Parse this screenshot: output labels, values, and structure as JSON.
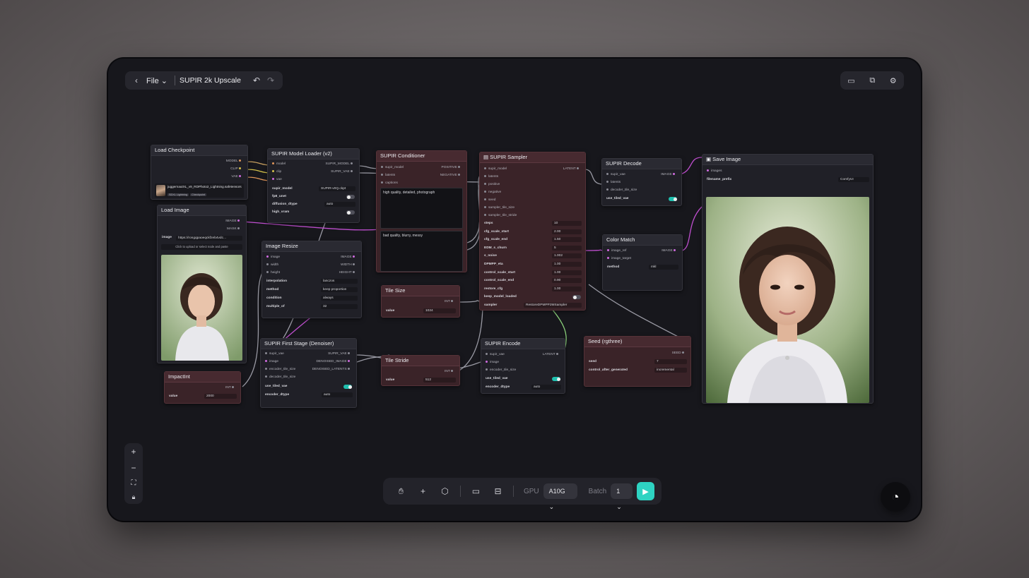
{
  "topbar": {
    "back_icon": "chevron-left-icon",
    "file_label": "File",
    "workflow_title": "SUPIR 2k Upscale",
    "undo_icon": "undo-icon",
    "redo_icon": "redo-icon"
  },
  "topright": {
    "icons": [
      "chat-bubble-icon",
      "queue-icon",
      "gear-icon"
    ]
  },
  "nodes": {
    "load_checkpoint": {
      "title": "Load Checkpoint",
      "outputs": [
        "MODEL",
        "CLIP",
        "VAE"
      ],
      "ckpt_name": "juggernautXL_v9_RDPhoto2_Lightning.safetensors",
      "tags": [
        "SDXL Lightning",
        "Checkpoint"
      ]
    },
    "load_image": {
      "title": "Load Image",
      "outputs": [
        "IMAGE",
        "MASK"
      ],
      "image_label": "image",
      "image_value": "https://rongqpaoeqckfzeb4vdc...",
      "upload_hint": "Click to upload or select node and paste"
    },
    "supir_model_loader": {
      "title": "SUPIR Model Loader (v2)",
      "inputs": [
        "model",
        "clip",
        "vae"
      ],
      "outputs": [
        "SUPIR_MODEL",
        "SUPIR_VAE"
      ],
      "supir_model_label": "supir_model",
      "supir_model_value": "SUPIR-v0Q.ckpt",
      "fp8_unet_label": "fp8_unet",
      "diffusion_dtype_label": "diffusion_dtype",
      "diffusion_dtype_value": "auto",
      "high_vram_label": "high_vram"
    },
    "image_resize": {
      "title": "Image Resize",
      "inputs": [
        "image",
        "width",
        "height"
      ],
      "outputs": [
        "IMAGE",
        "WIDTH",
        "HEIGHT"
      ],
      "interpolation_label": "interpolation",
      "interpolation_value": "lanczos",
      "method_label": "method",
      "method_value": "keep proportion",
      "condition_label": "condition",
      "condition_value": "always",
      "multiple_of_label": "multiple_of",
      "multiple_of_value": "32"
    },
    "supir_conditioner": {
      "title": "SUPIR Conditioner",
      "inputs": [
        "supir_model",
        "latents",
        "captions"
      ],
      "outputs": [
        "POSITIVE",
        "NEGATIVE"
      ],
      "positive_prompt": "high quality, detailed, photograph",
      "negative_prompt": "bad quality, blurry, messy"
    },
    "tile_size": {
      "title": "Tile Size",
      "output": "INT",
      "value_label": "value",
      "value": "1024"
    },
    "tile_stride": {
      "title": "Tile Stride",
      "output": "INT",
      "value_label": "value",
      "value": "512"
    },
    "supir_sampler": {
      "title": "SUPIR Sampler",
      "inputs": [
        "supir_model",
        "latents",
        "positive",
        "negative",
        "seed",
        "sampler_tile_size",
        "sampler_tile_stride"
      ],
      "output": "LATENT",
      "params": [
        {
          "label": "steps",
          "value": "10"
        },
        {
          "label": "cfg_scale_start",
          "value": "2.00"
        },
        {
          "label": "cfg_scale_end",
          "value": "1.50"
        },
        {
          "label": "EDM_s_churn",
          "value": "5"
        },
        {
          "label": "s_noise",
          "value": "1.002"
        },
        {
          "label": "DPMPP_eta",
          "value": "1.00"
        },
        {
          "label": "control_scale_start",
          "value": "1.00"
        },
        {
          "label": "control_scale_end",
          "value": "0.90"
        },
        {
          "label": "restore_cfg",
          "value": "1.00"
        }
      ],
      "keep_model_loaded_label": "keep_model_loaded",
      "sampler_label": "sampler",
      "sampler_value": "RestoreDPMPP2MSampler"
    },
    "supir_decode": {
      "title": "SUPIR Decode",
      "inputs": [
        "supir_vae",
        "latents",
        "decoder_tile_size"
      ],
      "output": "IMAGE",
      "use_tiled_vae_label": "use_tiled_vae"
    },
    "color_match": {
      "title": "Color Match",
      "inputs": [
        "image_ref",
        "image_target"
      ],
      "output": "IMAGE",
      "method_label": "method",
      "method_value": "mkl"
    },
    "supir_first_stage": {
      "title": "SUPIR First Stage (Denoiser)",
      "inputs": [
        "supir_vae",
        "image",
        "encoder_tile_size",
        "decoder_tile_size"
      ],
      "outputs": [
        "SUPIR_VAE",
        "DENOISED_IMAGE",
        "DENOISED_LATENTS"
      ],
      "use_tiled_vae_label": "use_tiled_vae",
      "encoder_dtype_label": "encoder_dtype",
      "encoder_dtype_value": "auto"
    },
    "supir_encode": {
      "title": "SUPIR Encode",
      "inputs": [
        "supir_vae",
        "image",
        "encoder_tile_size"
      ],
      "output": "LATENT",
      "use_tiled_vae_label": "use_tiled_vae",
      "encoder_dtype_label": "encoder_dtype",
      "encoder_dtype_value": "auto"
    },
    "impact_int": {
      "title": "ImpactInt",
      "output": "INT",
      "value_label": "value",
      "value": "2000"
    },
    "seed": {
      "title": "Seed (rgthree)",
      "output": "SEED",
      "seed_label": "seed",
      "seed_value": "7",
      "control_label": "control_after_generated",
      "control_value": "incremental"
    },
    "save_image": {
      "title": "Save Image",
      "inputs": [
        "images"
      ],
      "filename_prefix_label": "filename_prefix",
      "filename_prefix_value": "ComfyUI"
    }
  },
  "zoom_controls": {
    "icons": [
      "plus-icon",
      "minus-icon",
      "fit-view-icon",
      "lock-icon"
    ]
  },
  "bottombar": {
    "icons": [
      "hand-icon",
      "plus-icon",
      "cube-icon",
      "terminal-icon",
      "layout-icon"
    ],
    "gpu_label": "GPU",
    "gpu_value": "A10G",
    "batch_label": "Batch",
    "batch_value": "1",
    "run_icon": "play-icon"
  },
  "colors": {
    "accent": "#2ed3c2",
    "node_red": "#3a2328",
    "node_dark": "#202027",
    "wire_pink": "#c04fd0"
  }
}
